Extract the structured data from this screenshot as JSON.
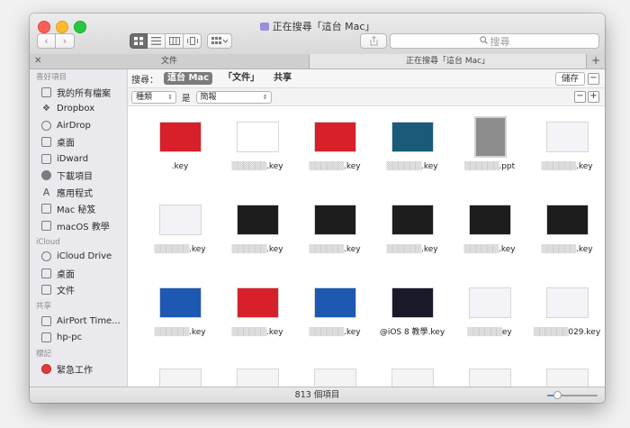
{
  "window": {
    "title": "正在搜尋「這台 Mac」",
    "search_placeholder": "搜尋"
  },
  "tabs": [
    {
      "label": "文件"
    },
    {
      "label": "正在搜尋「這台 Mac」"
    }
  ],
  "sidebar": {
    "sections": [
      {
        "title": "喜好項目",
        "items": [
          {
            "label": "我的所有檔案",
            "icon": "all-files-icon"
          },
          {
            "label": "Dropbox",
            "icon": "dropbox-icon"
          },
          {
            "label": "AirDrop",
            "icon": "airdrop-icon"
          },
          {
            "label": "桌面",
            "icon": "desktop-icon"
          },
          {
            "label": "iDward",
            "icon": "home-icon"
          },
          {
            "label": "下載項目",
            "icon": "downloads-icon"
          },
          {
            "label": "應用程式",
            "icon": "applications-icon"
          },
          {
            "label": "Mac 秘笈",
            "icon": "folder-icon"
          },
          {
            "label": "macOS 教學",
            "icon": "folder-icon"
          }
        ]
      },
      {
        "title": "iCloud",
        "items": [
          {
            "label": "iCloud Drive",
            "icon": "cloud-icon"
          },
          {
            "label": "桌面",
            "icon": "desktop-icon"
          },
          {
            "label": "文件",
            "icon": "document-icon"
          }
        ]
      },
      {
        "title": "共享",
        "items": [
          {
            "label": "AirPort Time...",
            "icon": "server-icon"
          },
          {
            "label": "hp-pc",
            "icon": "computer-icon"
          }
        ]
      },
      {
        "title": "標記",
        "items": [
          {
            "label": "緊急工作",
            "icon": "red-tag-icon"
          }
        ]
      }
    ]
  },
  "scope": {
    "label": "搜尋：",
    "options": [
      "這台 Mac",
      "「文件」",
      "共享"
    ],
    "active_index": 0,
    "save_label": "儲存",
    "remove_label": "−"
  },
  "criteria": {
    "attribute": "種類",
    "operator": "是",
    "value": "簡報",
    "remove_label": "−",
    "add_label": "+"
  },
  "files": [
    {
      "name": ".key",
      "thumb": "#d8202a",
      "line2": ""
    },
    {
      "name": ".key",
      "thumb": "#ffffff",
      "line2": "",
      "blur1": true
    },
    {
      "name": ".key",
      "thumb": "#d8202a",
      "line2": "",
      "blur1": true
    },
    {
      "name": ".key",
      "thumb": "#1a5b7a",
      "line2": "",
      "blur1": true
    },
    {
      "name": ".ppt",
      "thumb": "#8c8c8c",
      "line2": "",
      "blur1": true,
      "ppt": true
    },
    {
      "name": ".key",
      "thumb": "#f4f4f8",
      "line2": "",
      "blur1": true
    },
    {
      "name": ".key",
      "thumb": "#f2f2f7",
      "line2": "",
      "blur1": true
    },
    {
      "name": ".key",
      "thumb": "#1d1d1d",
      "line2": "",
      "blur1": true
    },
    {
      "name": ".key",
      "thumb": "#1d1d1d",
      "line2": "",
      "blur1": true
    },
    {
      "name": ".key",
      "thumb": "#1d1d1d",
      "line2": "",
      "blur1": true
    },
    {
      "name": ".key",
      "thumb": "#1d1d1d",
      "line2": "",
      "blur1": true
    },
    {
      "name": ".key",
      "thumb": "#1d1d1d",
      "line2": "",
      "blur1": true
    },
    {
      "name": ".key",
      "thumb": "#1d59b3",
      "line2": "",
      "blur1": true
    },
    {
      "name": ".key",
      "thumb": "#d8202a",
      "line2": "",
      "blur1": true
    },
    {
      "name": ".key",
      "thumb": "#1d59b3",
      "line2": "",
      "blur1": true
    },
    {
      "name": "@iOS 8 教學.key",
      "thumb": "#1a1a2a",
      "line2": ""
    },
    {
      "name": "ey",
      "thumb": "#f3f3f8",
      "line2": "",
      "blur1": true
    },
    {
      "name": "029.key",
      "thumb": "#f3f3f8",
      "line2": "",
      "blur1": true
    }
  ],
  "status": {
    "item_count": "813 個項目",
    "zoom_level": 0.2
  },
  "colors": {
    "close": "#fc5f57",
    "minimize": "#fdbc2e",
    "maximize": "#28c840",
    "accent": "#4a90e2"
  }
}
